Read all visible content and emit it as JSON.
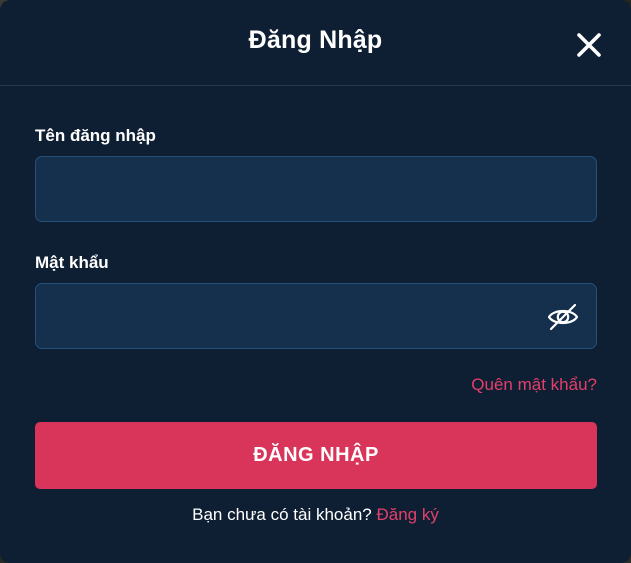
{
  "modal": {
    "title": "Đăng Nhập",
    "close_icon": "close-icon"
  },
  "form": {
    "username": {
      "label": "Tên đăng nhập",
      "value": "",
      "placeholder": ""
    },
    "password": {
      "label": "Mật khẩu",
      "value": "",
      "placeholder": "",
      "toggle_icon": "eye-slash-icon"
    },
    "forgot_password": "Quên mật khẩu?",
    "submit_label": "ĐĂNG NHẬP",
    "register_prompt": "Bạn chưa có tài khoản?",
    "register_link": "Đăng ký"
  },
  "colors": {
    "modal_bg": "#0f1f33",
    "input_bg": "#14304d",
    "input_border": "#24507a",
    "accent": "#d9345a",
    "link": "#e0406a",
    "text": "#ffffff"
  }
}
